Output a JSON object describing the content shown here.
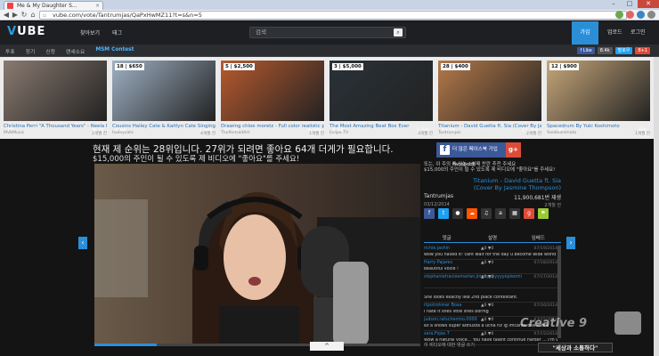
{
  "browser": {
    "tab_title": "Me & My Daughter S...",
    "url": "vube.com/vote/Tantrumjas/QaPxHwMZ11?t=s&n=5",
    "win_minimize": "–",
    "win_maximize": "□",
    "win_close": "✕"
  },
  "header": {
    "logo_v": "V",
    "logo_rest": "UBE",
    "nav": [
      "찾아보기",
      "태그"
    ],
    "search_placeholder": "검색",
    "join": "가입",
    "right": [
      "업로드",
      "로그인"
    ]
  },
  "subnav": {
    "items": [
      "투표",
      "정기",
      "신청",
      "랜세소요",
      "MSM Contest"
    ],
    "social": [
      "f Like",
      "8.4k",
      "팔로우",
      "8+1"
    ]
  },
  "thumbnails": [
    {
      "badge": "",
      "views_left": "20",
      "views_right": "9.7k",
      "title": "Christina Perri \"A Thousand Years\" - Neela B...",
      "channel": "MVBMusic",
      "age": "2개월 전",
      "bg": "#8a7a70"
    },
    {
      "badge": "18 | $650",
      "views_left": "4.6k",
      "views_right": "1.9m",
      "title": "Cousins Hailey Cate & Kaitlyn Cate Singing \"ar...",
      "channel": "haileycate",
      "age": "4개월 전",
      "bg": "#9fb1c4"
    },
    {
      "badge": "5 | $2,500",
      "views_left": "22.3k",
      "views_right": "6.6m",
      "title": "Drawing chloe moretz - Full color realistic past...",
      "channel": "ThePortraitArt",
      "age": "1개월 전",
      "bg": "#b85a2e"
    },
    {
      "badge": "3 | $5,000",
      "views_left": "4.5k",
      "views_right": "1.5m",
      "title": "The Most Amazing Beat Box Ever",
      "channel": "Eclipe TV",
      "age": "3개월 전",
      "bg": "#2a3238"
    },
    {
      "badge": "28 | $400",
      "views_left": "27.5k",
      "views_right": "11.9m",
      "title": "Titanium - David Guetta ft. Sia (Cover By Jas...",
      "channel": "Tantrumjas",
      "age": "2개월 전",
      "bg": "#b57a4a"
    },
    {
      "badge": "12 | $900",
      "views_left": "12.8k",
      "views_right": "6m",
      "title": "Spacedrum By Yuki Koshimoto",
      "channel": "YukiKoshimoto",
      "age": "1개월 전",
      "bg": "#c7a77a"
    }
  ],
  "main": {
    "rank_line": "현재 제 순위는 28위입니다. 27위가 되려면 좋아요 64개 더게가 필요합니다.",
    "goal_line": "$15,000의 주인이 될 수 있도록 제 비디오에 \"좋아요\"를 주세요!"
  },
  "sidebar": {
    "fb_button": "더 많은 페이스북 가입 Facebook",
    "promo1": "또는, 이 주의 우 있는 1번째 찬란 추전 주세요",
    "promo2": "$15,000의 주인이 될 수 있도록 제 비디오에 \"좋아요\"를 주세요!",
    "video_title": "Titanium - David Guetta ft. Sia (Cover By Jasmine Thompson)",
    "artist": "Tantrumjas",
    "view_count": "11,900,681번 재생",
    "date": "03/12/2014",
    "date_right": "2개월 전",
    "comment_tabs": [
      "댓글",
      "설명",
      "임베드"
    ],
    "comments": [
      {
        "user": "richie.jashin",
        "votes": "▲0 ▼0",
        "date": "07/19/2014",
        "text": "wow you nailed it! cant wait for the day u become wide world famous <3"
      },
      {
        "user": "Harry Pajares",
        "votes": "▲0 ▼0",
        "date": "07/18/2014",
        "text": "beautiful voice !"
      },
      {
        "user": "stephanietracieemarian.jimmyyyyyyyepleomi",
        "votes": "▲0 ▼0",
        "date": "07/17/2014",
        "text": ""
      },
      {
        "user": "",
        "votes": "",
        "date": "",
        "text": "She looks exactly like 2nd place contestant."
      },
      {
        "user": "rtpotrohmer Bosa",
        "votes": "▲0 ▼0",
        "date": "07/16/2014",
        "text": "I hate it shes little shes boring"
      },
      {
        "user": "judson.ratschenmo.0000",
        "votes": "▲0 ▼0",
        "date": "07/15/2014",
        "text": "ez a shows super adhuzza a ucha riz ig imcanta bsa xonta"
      },
      {
        "user": "sara.Fojas 7",
        "votes": "▲0 ▼0",
        "date": "07/15/2014",
        "text": "Wow a natural voice... You have talent continue harder ... I'm very u..."
      }
    ],
    "more_comments": "이 비디오에 대한 댓글 쓰기"
  },
  "watermark": {
    "text": "Creative 9",
    "slogan": "\"세상과 소통하다\""
  },
  "icons": {
    "back": "◀",
    "forward": "▶",
    "reload": "↻",
    "home": "⌂",
    "arrow_left": "‹",
    "arrow_right": "›",
    "up": "^"
  }
}
